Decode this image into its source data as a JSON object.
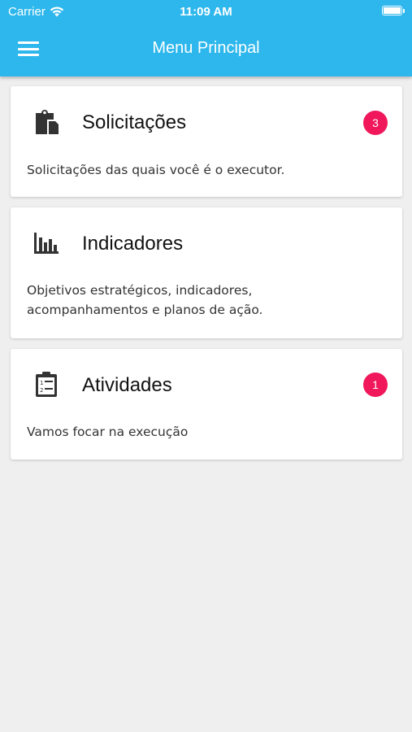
{
  "status_bar": {
    "carrier": "Carrier",
    "time": "11:09 AM"
  },
  "app_bar": {
    "title": "Menu Principal",
    "menu_icon": "hamburger-menu-icon",
    "background_color": "#2db7ec"
  },
  "cards": [
    {
      "icon": "clipboard-paste-icon",
      "title": "Solicitações",
      "badge": "3",
      "description": "Solicitações das quais você é o executor."
    },
    {
      "icon": "bar-chart-icon",
      "title": "Indicadores",
      "badge": "",
      "description_lines": [
        "Objetivos estratégicos, indicadores,",
        "acompanhamentos e planos de ação."
      ]
    },
    {
      "icon": "clipboard-list-icon",
      "title": "Atividades",
      "badge": "1",
      "description": "Vamos focar na execução"
    }
  ],
  "badge_color": "#f0175b"
}
